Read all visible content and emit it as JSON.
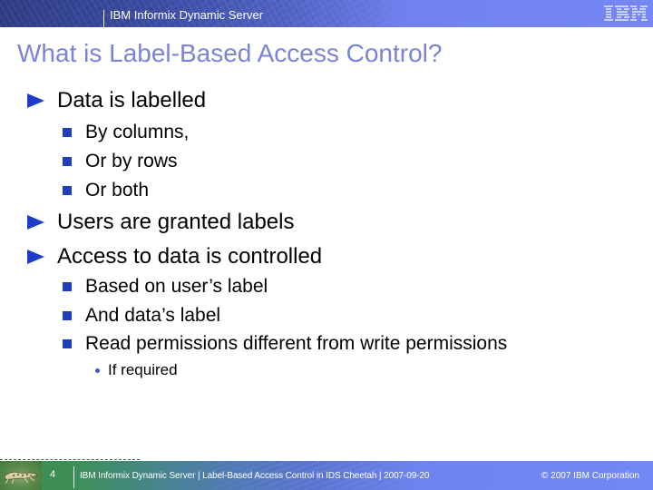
{
  "header": {
    "product": "IBM Informix Dynamic Server",
    "logo": "IBM"
  },
  "slide": {
    "title": "What is Label-Based Access Control?",
    "bullets": [
      {
        "text": "Data is labelled",
        "children": [
          {
            "text": "By columns,"
          },
          {
            "text": "Or by rows"
          },
          {
            "text": "Or both"
          }
        ]
      },
      {
        "text": "Users are granted labels"
      },
      {
        "text": "Access to data is controlled",
        "children": [
          {
            "text": "Based on user’s label"
          },
          {
            "text": "And data’s label"
          },
          {
            "text": "Read permissions different from write permissions",
            "children": [
              {
                "text": "If required"
              }
            ]
          }
        ]
      }
    ]
  },
  "footer": {
    "page_number": "4",
    "text": "IBM Informix Dynamic Server  |  Label-Based Access Control in IDS Cheetah | 2007-09-20",
    "copyright": "© 2007 IBM Corporation"
  },
  "colors": {
    "title": "#7b83d9",
    "bullet_accent": "#1e3cc8",
    "header_band": "#7487f5",
    "footer_green": "#3e8f57"
  }
}
